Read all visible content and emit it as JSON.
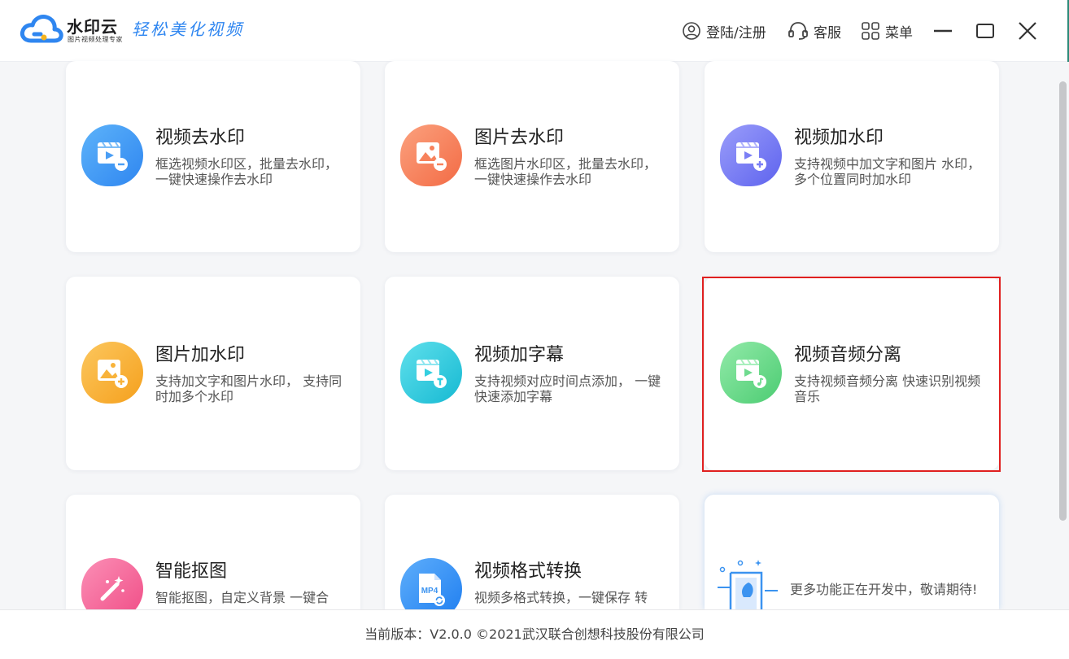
{
  "app": {
    "brand": "水印云",
    "brand_sub": "图片视频处理专家",
    "slogan": "轻松美化视频"
  },
  "toolbar": {
    "login_label": "登陆/注册",
    "service_label": "客服",
    "menu_label": "菜单"
  },
  "cards": [
    {
      "title": "视频去水印",
      "desc": "框选视频水印区，批量去水印，一键快速操作去水印"
    },
    {
      "title": "图片去水印",
      "desc": "框选图片水印区，批量去水印，一键快速操作去水印"
    },
    {
      "title": "视频加水印",
      "desc": "支持视频中加文字和图片 水印，多个位置同时加水印"
    },
    {
      "title": "图片加水印",
      "desc": "支持加文字和图片水印， 支持同时加多个水印"
    },
    {
      "title": "视频加字幕",
      "desc": "支持视频对应时间点添加， 一键快速添加字幕"
    },
    {
      "title": "视频音频分离",
      "desc": "支持视频音频分离 快速识别视频音乐"
    },
    {
      "title": "智能抠图",
      "desc": "智能抠图，自定义背景 一键合"
    },
    {
      "title": "视频格式转换",
      "desc": "视频多格式转换，一键保存 转"
    }
  ],
  "coming_soon": {
    "text": "更多功能正在开发中，敬请期待!"
  },
  "icons": {
    "mp4_label": "MP4"
  },
  "footer": {
    "text": "当前版本：V2.0.0 ©2021武汉联合创想科技股份有限公司"
  },
  "colors": {
    "blue": "#4a9ef5",
    "orange": "#f7825c",
    "purple": "#7b7ff5",
    "yellow": "#f8b33a",
    "cyan": "#34cfe0",
    "green": "#6fdb8f",
    "pink": "#f7699c",
    "azure": "#3b93f0",
    "selection": "#e02020"
  }
}
